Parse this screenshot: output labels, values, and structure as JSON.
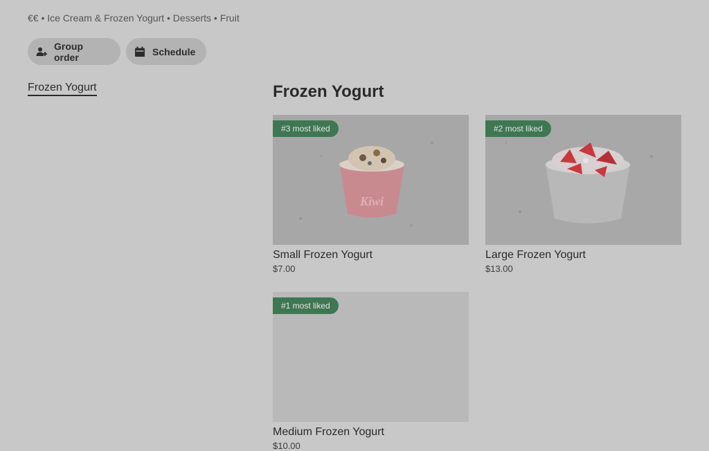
{
  "store": {
    "meta": "€€ • Ice Cream & Frozen Yogurt • Desserts • Fruit"
  },
  "actions": {
    "group_order": "Group order",
    "schedule": "Schedule"
  },
  "category_nav": {
    "items": [
      "Frozen Yogurt"
    ]
  },
  "section": {
    "title": "Frozen Yogurt"
  },
  "products": [
    {
      "badge": "#3 most liked",
      "name": "Small Frozen Yogurt",
      "price": "$7.00",
      "cup_color": "#c98a8f"
    },
    {
      "badge": "#2 most liked",
      "name": "Large Frozen Yogurt",
      "price": "$13.00",
      "cup_color": "#b9b9b9"
    },
    {
      "badge": "#1 most liked",
      "name": "Medium Frozen Yogurt",
      "price": "$10.00"
    }
  ],
  "colors": {
    "badge_green": "#3f7753",
    "background": "#c8c8c8"
  }
}
